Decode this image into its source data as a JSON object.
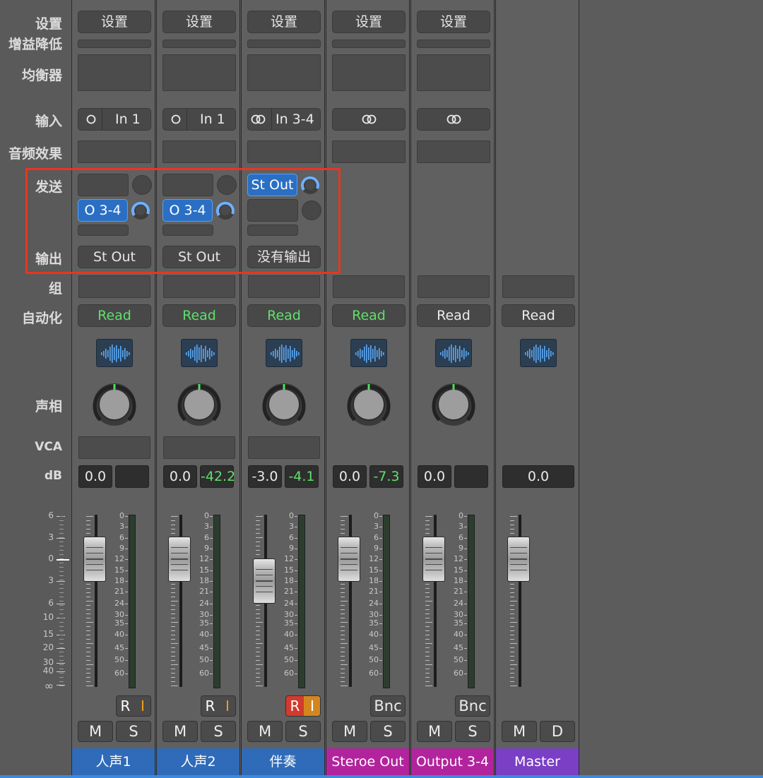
{
  "row_labels": {
    "settings": "设置",
    "gain_reduction": "增益降低",
    "eq": "均衡器",
    "input": "输入",
    "audio_fx": "音频效果",
    "sends": "发送",
    "output": "输出",
    "group": "组",
    "automation": "自动化",
    "pan": "声相",
    "vca": "VCA",
    "db": "dB"
  },
  "fader_scale_left": [
    "6",
    "3",
    "0",
    "3",
    "6",
    "10",
    "15",
    "20",
    "30",
    "40",
    "∞"
  ],
  "meter_scale": [
    "0",
    "3",
    "6",
    "9",
    "12",
    "15",
    "18",
    "21",
    "24",
    "30",
    "35",
    "40",
    "45",
    "50",
    "60"
  ],
  "strips": [
    {
      "name": "人声1",
      "name_color": "#2f6bb8",
      "setting": "设置",
      "input": {
        "icon": "mono-circle-icon",
        "label": "In 1"
      },
      "sends": [
        {
          "label": "",
          "active": false
        },
        {
          "label": "O 3-4",
          "active": true
        }
      ],
      "output": "St Out",
      "automation": "Read",
      "automation_green": true,
      "db_fader": "0.0",
      "db_peak": "",
      "fader_level_db": 0,
      "record": "R",
      "input_monitor": "I",
      "mute": "M",
      "solo": "S"
    },
    {
      "name": "人声2",
      "name_color": "#2f6bb8",
      "setting": "设置",
      "input": {
        "icon": "mono-circle-icon",
        "label": "In 1"
      },
      "sends": [
        {
          "label": "",
          "active": false
        },
        {
          "label": "O 3-4",
          "active": true
        }
      ],
      "output": "St Out",
      "automation": "Read",
      "automation_green": true,
      "db_fader": "0.0",
      "db_peak": "-42.2",
      "fader_level_db": 0,
      "record": "R",
      "input_monitor": "I",
      "mute": "M",
      "solo": "S"
    },
    {
      "name": "伴奏",
      "name_color": "#2f6bb8",
      "setting": "设置",
      "input": {
        "icon": "stereo-circle-icon",
        "label": "In 3-4"
      },
      "sends": [
        {
          "label": "St Out",
          "active": true
        },
        {
          "label": "",
          "active": false
        }
      ],
      "output": "没有输出",
      "automation": "Read",
      "automation_green": true,
      "db_fader": "-3.0",
      "db_peak": "-4.1",
      "fader_level_db": -3,
      "record": "R",
      "input_monitor": "I",
      "record_armed": true,
      "mute": "M",
      "solo": "S"
    },
    {
      "name": "Steroe Out",
      "name_color": "#b2249d",
      "setting": "设置",
      "input": {
        "icon": "stereo-circle-icon",
        "label": ""
      },
      "sends": [],
      "output": "",
      "automation": "Read",
      "automation_green": true,
      "db_fader": "0.0",
      "db_peak": "-7.3",
      "fader_level_db": 0,
      "bounce": "Bnc",
      "mute": "M",
      "solo": "S"
    },
    {
      "name": "Output 3-4",
      "name_color": "#b2249d",
      "setting": "设置",
      "input": {
        "icon": "stereo-circle-icon",
        "label": ""
      },
      "sends": [],
      "output": "",
      "automation": "Read",
      "automation_green": false,
      "db_fader": "0.0",
      "db_peak": "",
      "fader_level_db": 0,
      "bounce": "Bnc",
      "mute": "M",
      "solo": "S"
    },
    {
      "name": "Master",
      "name_color": "#7a3fc4",
      "automation": "Read",
      "automation_green": false,
      "db_fader": "0.0",
      "fader_level_db": 0,
      "mute": "M",
      "dim": "D"
    }
  ]
}
